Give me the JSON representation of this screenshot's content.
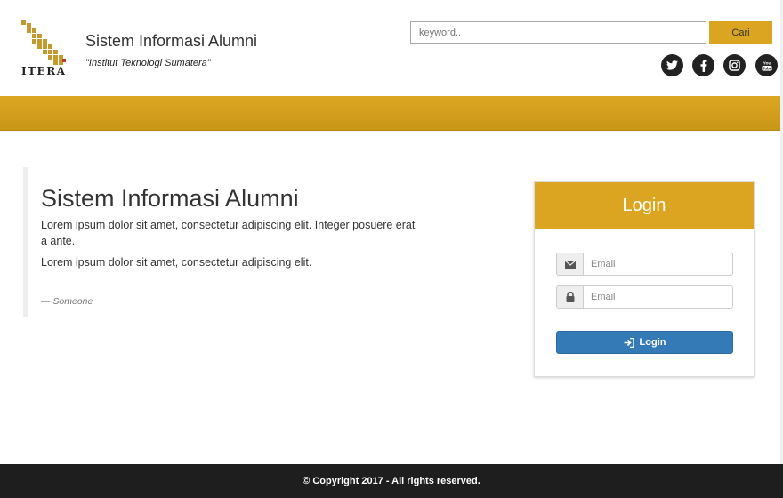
{
  "header": {
    "logo_text": "ITERA",
    "title": "Sistem Informasi Alumni",
    "subtitle": "\"Institut Teknologi Sumatera\"",
    "search_placeholder": "keyword..",
    "search_button": "Cari",
    "social_icons": [
      "twitter-icon",
      "facebook-icon",
      "instagram-icon",
      "youtube-icon"
    ]
  },
  "content": {
    "heading": "Sistem Informasi Alumni",
    "paragraph1": "Lorem ipsum dolor sit amet, consectetur adipiscing elit. Integer posuere erat a ante.",
    "paragraph2": "Lorem ipsum dolor sit amet, consectetur adipiscing elit.",
    "cite": "— Someone"
  },
  "login": {
    "title": "Login",
    "field1_placeholder": "Email",
    "field2_placeholder": "Email",
    "button_label": "Login"
  },
  "footer": {
    "copyright": "© Copyright 2017 - All rights reserved."
  },
  "colors": {
    "accent": "#dba521",
    "primary_button": "#337ab7",
    "footer_bg": "#1e1e1e"
  }
}
